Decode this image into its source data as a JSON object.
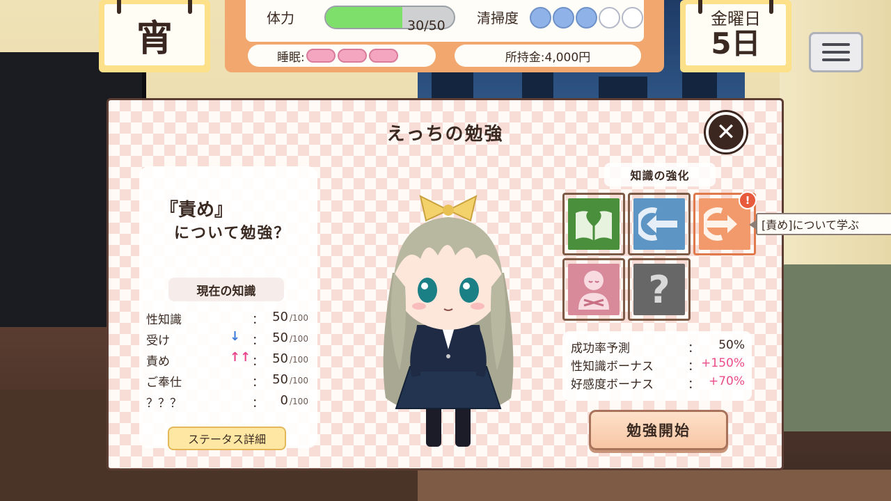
{
  "hud": {
    "time_of_day": "宵",
    "hp": {
      "label": "体力",
      "value": "30/50",
      "fraction": 0.6
    },
    "cleanliness": {
      "label": "清掃度",
      "level": 3,
      "max": 5
    },
    "sleep": {
      "label": "睡眠:",
      "level": 3,
      "max": 3
    },
    "money": "所持金:4,000円",
    "weekday": "金曜日",
    "day": "5日"
  },
  "dialog": {
    "title": "えっちの勉強",
    "question_topic": "『責め』",
    "question_text": "について勉強？",
    "knowledge_header": "現在の知識",
    "stats": [
      {
        "name": "性知識",
        "arrow": "",
        "value": "50",
        "max": "/100"
      },
      {
        "name": "受け",
        "arrow": "↓",
        "value": "50",
        "max": "/100"
      },
      {
        "name": "責め",
        "arrow": "↑↑",
        "value": "50",
        "max": "/100"
      },
      {
        "name": "ご奉仕",
        "arrow": "",
        "value": "50",
        "max": "/100"
      },
      {
        "name": "？？？",
        "arrow": "",
        "value": "0",
        "max": "/100"
      }
    ],
    "stat_colon": "：",
    "status_button": "ステータス詳細",
    "enhance_title": "知識の強化",
    "badge": "!",
    "tooltip": "[責め]について学ぶ",
    "bonus": [
      {
        "name": "成功率予測",
        "value": "50%"
      },
      {
        "name": "性知識ボーナス",
        "value": "+150%"
      },
      {
        "name": "好感度ボーナス",
        "value": "+70%"
      }
    ],
    "bonus_colon": "：",
    "start_button": "勉強開始",
    "colors": {
      "tile_green": "#4a8f3c",
      "tile_blue": "#5d95c5",
      "tile_orange": "#f29a6c",
      "tile_pink": "#d88a9a",
      "tile_gray": "#676767",
      "accent_pink": "#ec4d8a"
    }
  }
}
